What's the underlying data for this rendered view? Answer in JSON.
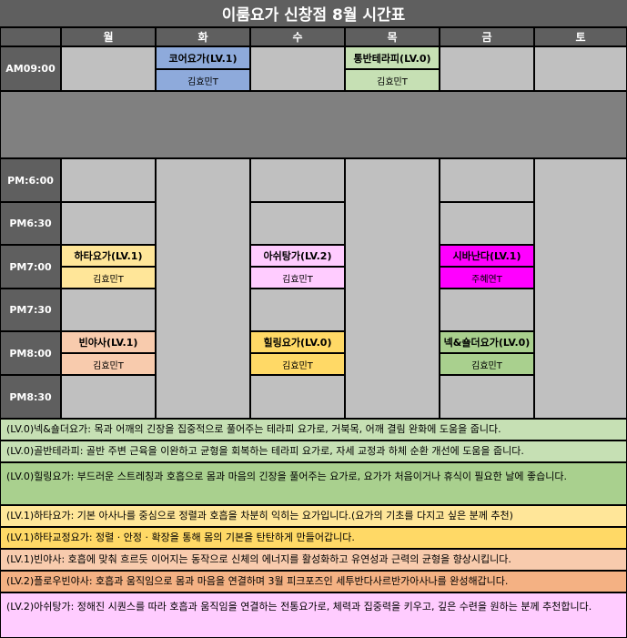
{
  "title": "이룸요가 신창점 8월 시간표",
  "days": [
    "월",
    "화",
    "수",
    "목",
    "금",
    "토"
  ],
  "times": {
    "am9": "AM09:00",
    "pm600": "PM:6:00",
    "pm630": "PM6:30",
    "pm700": "PM7:00",
    "pm730": "PM7:30",
    "pm800": "PM8:00",
    "pm830": "PM8:30"
  },
  "classes": {
    "tue_am9": {
      "name": "코어요가(LV.1)",
      "teacher": "김효민T"
    },
    "thu_am9": {
      "name": "통반테라피(LV.0)",
      "teacher": "김효민T"
    },
    "mon_pm7": {
      "name": "하타요가(LV.1)",
      "teacher": "김효민T"
    },
    "wed_pm7": {
      "name": "아쉬탕가(LV.2)",
      "teacher": "김효민T"
    },
    "fri_pm7": {
      "name": "시바난다(LV.1)",
      "teacher": "주혜연T"
    },
    "mon_pm8": {
      "name": "빈야사(LV.1)",
      "teacher": "김효민T"
    },
    "wed_pm8": {
      "name": "힐링요가(LV.0)",
      "teacher": "김효민T"
    },
    "fri_pm8": {
      "name": "넥&숄더요가(LV.0)",
      "teacher": "김효민T"
    }
  },
  "colors": {
    "header": "#5f5f5f",
    "empty": "#c0c0c0",
    "divider": "#808080",
    "core": "#8eaadb",
    "therapy": "#c6e0b4",
    "hatha": "#ffe699",
    "ashtanga": "#ffccff",
    "sivananda": "#ff00ff",
    "vinyasa": "#f8cbad",
    "healing": "#ffd966",
    "neck": "#a9d08e"
  },
  "descriptions": [
    {
      "tag": "(LV.0)넥&숄더요가:",
      "text": "목과 어깨의 긴장을 집중적으로 풀어주는 테라피 요가로, 거북목, 어깨 결림 완화에 도움을 줍니다."
    },
    {
      "tag": "(LV.0)골반테라피:",
      "text": "골반 주변 근육을 이완하고 균형을 회복하는 테라피 요가로, 자세 교정과 하체 순환 개선에 도움을 줍니다."
    },
    {
      "tag": "(LV.0)힐링요가:",
      "text": "부드러운 스트레칭과 호흡으로 몸과 마음의 긴장을 풀어주는 요가로, 요가가 처음이거나 휴식이 필요한 날에 좋습니다."
    },
    {
      "tag": "(LV.1)하타요가:",
      "text": "기본 아사나를 중심으로 정렬과 호흡을 차분히 익히는 요가입니다.(요가의 기초를 다지고 싶은 분께 추천)"
    },
    {
      "tag": "(LV.1)하타교정요가:",
      "text": "정렬 · 안정 · 확장을 통해 몸의 기본을 탄탄하게 만들어갑니다."
    },
    {
      "tag": "(LV.1)빈야사:",
      "text": "호흡에 맞춰 흐르듯 이어지는 동작으로 신체의 에너지를 활성화하고 유연성과 근력의 균형을 향상시킵니다."
    },
    {
      "tag": "(LV.2)플로우빈야사:",
      "text": "호흡과 움직임으로 몸과 마음을 연결하며 3월 피크포즈인 세투반다사르반가아사나를 완성해갑니다."
    },
    {
      "tag": "(LV.2)아쉬탕가:",
      "text": "정해진 시퀀스를 따라 호흡과 움직임을 연결하는 전통요가로, 체력과 집중력을 키우고, 깊은 수련을 원하는 분께 추천합니다."
    }
  ]
}
